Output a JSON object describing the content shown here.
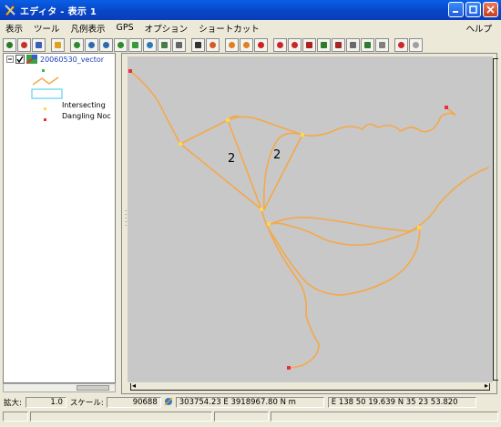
{
  "window": {
    "title": "エディタ - 表示 1",
    "controls": [
      "minimize",
      "maximize",
      "close"
    ]
  },
  "menu": {
    "items": [
      "表示",
      "ツール",
      "凡例表示",
      "GPS",
      "オプション",
      "ショートカット"
    ],
    "help": "ヘルプ"
  },
  "legend": {
    "layer_name": "20060530_vector",
    "entries": [
      "Intersecting",
      "Dangling Noc"
    ]
  },
  "map": {
    "labels": [
      "2",
      "2"
    ],
    "line_color": "#f5a84a",
    "node_color": "#ffd84a",
    "dangling_color": "#e8303a",
    "background": "#c8c8c8"
  },
  "status": {
    "zoom_label": "拡大:",
    "zoom_value": "1.0",
    "scale_label": "スケール:",
    "scale_value": "90688",
    "coord_xy": "303754.23 E   3918967.80 N m",
    "coord_geo": "E 138 50 19.639   N 35 23 53.820"
  },
  "colors": {
    "titlebar": "#0746c7",
    "chrome": "#ece9d8",
    "map_bg": "#c8c8c8"
  }
}
